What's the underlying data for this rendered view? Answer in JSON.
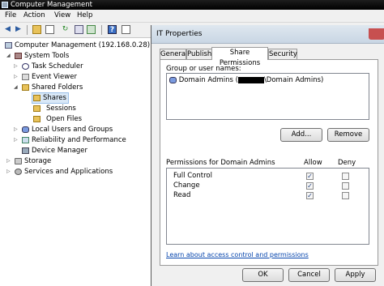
{
  "window": {
    "title": "Computer Management"
  },
  "menu": [
    "File",
    "Action",
    "View",
    "Help"
  ],
  "toolbar": {
    "icons": [
      "back-icon",
      "forward-icon",
      "up-folder-icon",
      "show-tree-icon",
      "refresh-icon",
      "export-icon",
      "help-icon",
      "properties-icon"
    ]
  },
  "tree": {
    "root": "Computer Management (192.168.0.28)",
    "system_tools": "System Tools",
    "task_scheduler": "Task Scheduler",
    "event_viewer": "Event Viewer",
    "shared_folders": "Shared Folders",
    "shares": "Shares",
    "sessions": "Sessions",
    "open_files": "Open Files",
    "local_users": "Local Users and Groups",
    "reliability": "Reliability and Performance",
    "device_manager": "Device Manager",
    "storage": "Storage",
    "services": "Services and Applications"
  },
  "dialog": {
    "title": "IT Properties",
    "tabs": [
      "General",
      "Publish",
      "Share Permissions",
      "Security"
    ],
    "active_tab": "Share Permissions",
    "group_label": "Group or user names:",
    "group_entry_prefix": "Domain Admins (",
    "group_entry_suffix": "\\Domain Admins)",
    "add_button": "Add...",
    "remove_button": "Remove",
    "perm_label": "Permissions for Domain Admins",
    "allow_header": "Allow",
    "deny_header": "Deny",
    "permissions": [
      {
        "name": "Full Control",
        "allow": true,
        "deny": false
      },
      {
        "name": "Change",
        "allow": true,
        "deny": false
      },
      {
        "name": "Read",
        "allow": true,
        "deny": false
      }
    ],
    "learn_link": "Learn about access control and permissions",
    "ok_button": "OK",
    "cancel_button": "Cancel",
    "apply_button": "Apply"
  }
}
